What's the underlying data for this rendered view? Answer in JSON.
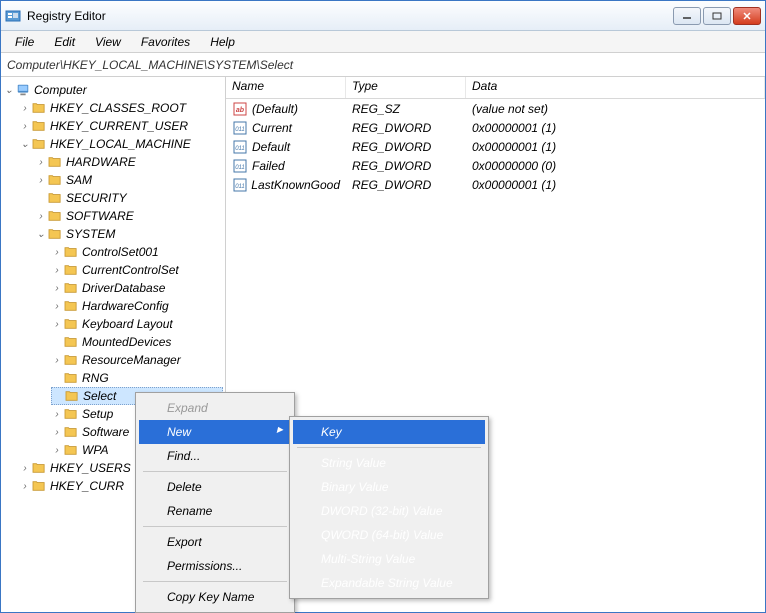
{
  "window": {
    "title": "Registry Editor"
  },
  "menubar": [
    "File",
    "Edit",
    "View",
    "Favorites",
    "Help"
  ],
  "address": "Computer\\HKEY_LOCAL_MACHINE\\SYSTEM\\Select",
  "tree": {
    "root": "Computer",
    "hives": [
      {
        "name": "HKEY_CLASSES_ROOT",
        "expanded": false
      },
      {
        "name": "HKEY_CURRENT_USER",
        "expanded": false
      },
      {
        "name": "HKEY_LOCAL_MACHINE",
        "expanded": true,
        "children": [
          {
            "name": "HARDWARE",
            "expanded": false
          },
          {
            "name": "SAM",
            "expanded": false
          },
          {
            "name": "SECURITY"
          },
          {
            "name": "SOFTWARE",
            "expanded": false
          },
          {
            "name": "SYSTEM",
            "expanded": true,
            "children": [
              {
                "name": "ControlSet001",
                "expanded": false
              },
              {
                "name": "CurrentControlSet",
                "expanded": false
              },
              {
                "name": "DriverDatabase",
                "expanded": false
              },
              {
                "name": "HardwareConfig",
                "expanded": false
              },
              {
                "name": "Keyboard Layout",
                "expanded": false
              },
              {
                "name": "MountedDevices"
              },
              {
                "name": "ResourceManager",
                "expanded": false
              },
              {
                "name": "RNG"
              },
              {
                "name": "Select",
                "selected": true
              },
              {
                "name": "Setup",
                "expanded": false
              },
              {
                "name": "Software",
                "expanded": false
              },
              {
                "name": "WPA",
                "expanded": false
              }
            ]
          }
        ]
      },
      {
        "name": "HKEY_USERS",
        "expanded": false,
        "truncated": "HKEY_USERS"
      },
      {
        "name": "HKEY_CURRENT_CONFIG",
        "expanded": false,
        "truncated": "HKEY_CURR"
      }
    ]
  },
  "list": {
    "headers": {
      "name": "Name",
      "type": "Type",
      "data": "Data"
    },
    "rows": [
      {
        "icon": "sz",
        "name": "(Default)",
        "type": "REG_SZ",
        "data": "(value not set)"
      },
      {
        "icon": "bin",
        "name": "Current",
        "type": "REG_DWORD",
        "data": "0x00000001 (1)"
      },
      {
        "icon": "bin",
        "name": "Default",
        "type": "REG_DWORD",
        "data": "0x00000001 (1)"
      },
      {
        "icon": "bin",
        "name": "Failed",
        "type": "REG_DWORD",
        "data": "0x00000000 (0)"
      },
      {
        "icon": "bin",
        "name": "LastKnownGood",
        "type": "REG_DWORD",
        "data": "0x00000001 (1)"
      }
    ]
  },
  "context_menu": {
    "items": [
      {
        "label": "Expand",
        "disabled": true
      },
      {
        "label": "New",
        "highlighted": true,
        "submenu": true
      },
      {
        "label": "Find..."
      },
      {
        "sep": true
      },
      {
        "label": "Delete"
      },
      {
        "label": "Rename"
      },
      {
        "sep": true
      },
      {
        "label": "Export"
      },
      {
        "label": "Permissions..."
      },
      {
        "sep": true
      },
      {
        "label": "Copy Key Name"
      }
    ],
    "submenu": [
      {
        "label": "Key",
        "highlighted": true
      },
      {
        "sep": true
      },
      {
        "label": "String Value"
      },
      {
        "label": "Binary Value"
      },
      {
        "label": "DWORD (32-bit) Value"
      },
      {
        "label": "QWORD (64-bit) Value"
      },
      {
        "label": "Multi-String Value"
      },
      {
        "label": "Expandable String Value"
      }
    ]
  }
}
